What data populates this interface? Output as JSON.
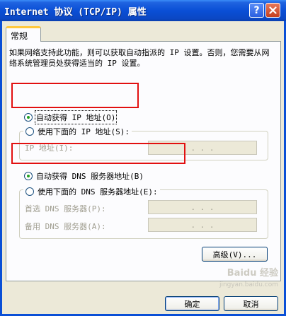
{
  "window": {
    "title": "Internet 协议 (TCP/IP) 属性",
    "help_label": "?",
    "close_label": "close"
  },
  "tabs": [
    {
      "label": "常规",
      "selected": true
    }
  ],
  "general": {
    "description": "如果网络支持此功能，则可以获取自动指派的 IP 设置。否则，您需要从网络系统管理员处获得适当的 IP 设置。",
    "ip_auto": {
      "label": "自动获得 IP 地址(O)",
      "selected": true
    },
    "ip_manual": {
      "label": "使用下面的 IP 地址(S):",
      "selected": false
    },
    "ip_fields": [
      {
        "label": "IP 地址(I):",
        "value": ". . ."
      }
    ],
    "dns_auto": {
      "label": "自动获得 DNS 服务器地址(B)",
      "selected": true
    },
    "dns_manual": {
      "label": "使用下面的 DNS 服务器地址(E):",
      "selected": false
    },
    "dns_fields": [
      {
        "label": "首选 DNS 服务器(P):",
        "value": ". . ."
      },
      {
        "label": "备用 DNS 服务器(A):",
        "value": ". . ."
      }
    ],
    "advanced_label": "高级(V)..."
  },
  "footer": {
    "ok_label": "确定",
    "cancel_label": "取消"
  },
  "watermark": {
    "text": "Baidu 经验",
    "url": "jingyan.baidu.com"
  },
  "colors": {
    "title_bar": "#0a4fd6",
    "highlight_box": "#e21010",
    "radio_dot": "#21a121"
  }
}
